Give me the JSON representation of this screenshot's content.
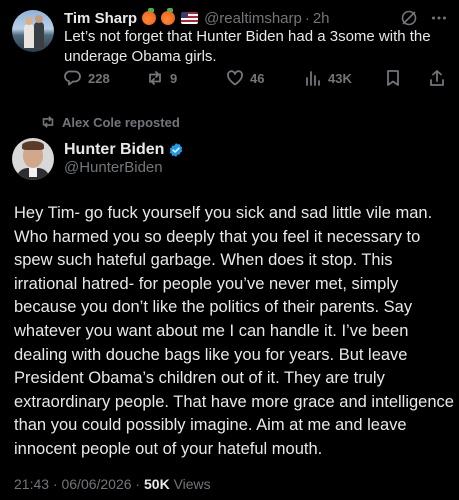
{
  "original_tweet": {
    "author_name": "Tim Sharp",
    "handle": "@realtimsharp",
    "time": "2h",
    "text": "Let’s not forget that Hunter Biden had  a 3some with the underage Obama girls.",
    "replies": "228",
    "reposts": "9",
    "likes": "46",
    "views": "43K"
  },
  "repost_banner": {
    "text": "Alex Cole reposted"
  },
  "main_tweet": {
    "author_name": "Hunter Biden",
    "handle": "@HunterBiden",
    "text": "Hey Tim- go fuck yourself you sick and sad little vile man. Who harmed you so deeply that you feel it necessary to spew such hateful garbage. When does it stop. This irrational hatred- for people you’ve never met, simply because you don’t like the politics of their parents. Say whatever you want about me I can handle it. I’ve been dealing with douche bags like you for years. But leave President Obama’s children out of it. They are truly extraordinary people. That have more grace and intelligence than you could possibly imagine. Aim at me and leave innocent people out of your hateful mouth.",
    "timestamp": "21:43 · 06/06/2026 · ",
    "views_count": "50K",
    "views_label": "Views"
  },
  "colors": {
    "background": "#000000",
    "text": "#e7e9ea",
    "muted": "#71767b",
    "verified": "#1d9bf0"
  }
}
